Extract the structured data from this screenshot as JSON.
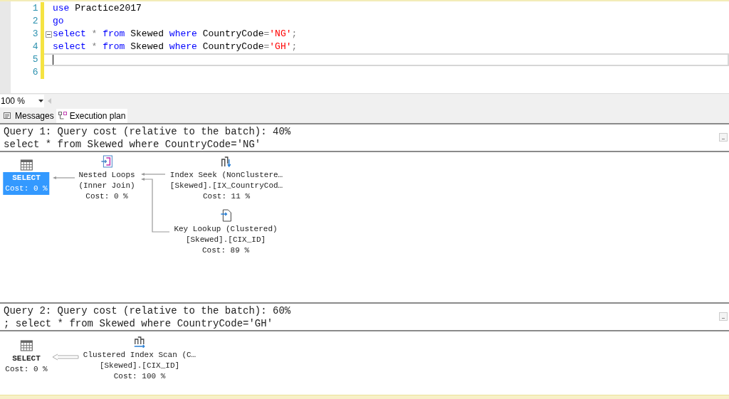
{
  "editor": {
    "lines": [
      {
        "number": "1",
        "current": false,
        "folded_start": false,
        "tokens": [
          {
            "text": "use",
            "kind": "keyword"
          },
          {
            "text": " Practice2017",
            "kind": "plain"
          }
        ]
      },
      {
        "number": "2",
        "current": false,
        "folded_start": false,
        "tokens": [
          {
            "text": "go",
            "kind": "keyword"
          }
        ]
      },
      {
        "number": "3",
        "current": false,
        "folded_start": true,
        "tokens": [
          {
            "text": "select",
            "kind": "keyword"
          },
          {
            "text": " * ",
            "kind": "operator"
          },
          {
            "text": "from",
            "kind": "keyword"
          },
          {
            "text": " Skewed ",
            "kind": "plain"
          },
          {
            "text": "where",
            "kind": "keyword"
          },
          {
            "text": " CountryCode",
            "kind": "plain"
          },
          {
            "text": "=",
            "kind": "operator"
          },
          {
            "text": "'NG'",
            "kind": "string"
          },
          {
            "text": ";",
            "kind": "operator"
          }
        ]
      },
      {
        "number": "4",
        "current": false,
        "folded_start": false,
        "tokens": [
          {
            "text": "select",
            "kind": "keyword"
          },
          {
            "text": " * ",
            "kind": "operator"
          },
          {
            "text": "from",
            "kind": "keyword"
          },
          {
            "text": " Skewed ",
            "kind": "plain"
          },
          {
            "text": "where",
            "kind": "keyword"
          },
          {
            "text": " CountryCode",
            "kind": "plain"
          },
          {
            "text": "=",
            "kind": "operator"
          },
          {
            "text": "'GH'",
            "kind": "string"
          },
          {
            "text": ";",
            "kind": "operator"
          }
        ]
      },
      {
        "number": "5",
        "current": true,
        "folded_start": false
      },
      {
        "number": "6",
        "current": false,
        "folded_start": false
      }
    ]
  },
  "zoom": {
    "value": "100 %"
  },
  "tabs": [
    {
      "label": "Messages",
      "kind": "messages",
      "selected": false
    },
    {
      "label": "Execution plan",
      "kind": "plan",
      "selected": true
    }
  ],
  "queries": [
    {
      "header": "Query 1: Query cost (relative to the batch): 40%",
      "statement": "select * from Skewed where CountryCode='NG'",
      "nodes": [
        {
          "kind": "select",
          "selected": true,
          "lines": [
            "SELECT",
            "Cost: 0 %"
          ]
        },
        {
          "kind": "nested_loops",
          "selected": false,
          "lines": [
            "Nested Loops",
            "(Inner Join)",
            "Cost: 0 %"
          ]
        },
        {
          "kind": "index_seek",
          "selected": false,
          "lines": [
            "Index Seek (NonClustere…",
            "[Skewed].[IX_CountryCod…",
            "Cost: 11 %"
          ]
        },
        {
          "kind": "key_lookup",
          "selected": false,
          "lines": [
            "Key Lookup (Clustered)",
            "[Skewed].[CIX_ID]",
            "Cost: 89 %"
          ]
        }
      ]
    },
    {
      "header": "Query 2: Query cost (relative to the batch): 60%",
      "statement": "; select * from Skewed where CountryCode='GH'",
      "nodes": [
        {
          "kind": "select",
          "selected": false,
          "lines": [
            "SELECT",
            "Cost: 0 %"
          ]
        },
        {
          "kind": "clustered_index_scan",
          "selected": false,
          "lines": [
            "Clustered Index Scan (C…",
            "[Skewed].[CIX_ID]",
            "Cost: 100 %"
          ]
        }
      ]
    }
  ]
}
